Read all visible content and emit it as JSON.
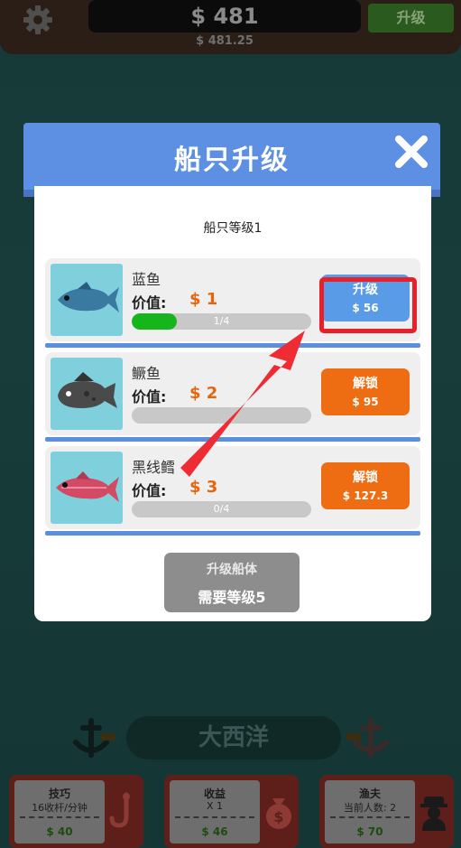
{
  "top": {
    "money": "$ 481",
    "money_exact": "$ 481.25",
    "upgrade_label": "升级"
  },
  "dialog": {
    "title": "船只升级",
    "level_label": "船只等级1",
    "fish": [
      {
        "name": "蓝鱼",
        "value_label": "价值:",
        "value": "$ 1",
        "progress_text": "1/4",
        "progress": 0.25,
        "button_label": "升级",
        "button_cost": "$ 56",
        "button_type": "upgrade"
      },
      {
        "name": "鳜鱼",
        "value_label": "价值:",
        "value": "$ 2",
        "progress_text": "",
        "progress": 0,
        "button_label": "解锁",
        "button_cost": "$ 95",
        "button_type": "unlock"
      },
      {
        "name": "黑线鳕",
        "value_label": "价值:",
        "value": "$ 3",
        "progress_text": "0/4",
        "progress": 0,
        "button_label": "解锁",
        "button_cost": "$ 127.3",
        "button_type": "unlock"
      }
    ],
    "hull_button": {
      "title": "升级船体",
      "requirement": "需要等级5"
    }
  },
  "bottom": {
    "ocean_name": "大西洋",
    "cards": [
      {
        "title": "技巧",
        "sub": "16收杆/分钟",
        "price": "$ 40",
        "icon": "hook-icon"
      },
      {
        "title": "收益",
        "sub": "X 1",
        "price": "$ 46",
        "icon": "money-bag-icon"
      },
      {
        "title": "渔夫",
        "sub": "当前人数: 2",
        "price": "$ 70",
        "icon": "fisherman-icon"
      }
    ]
  },
  "colors": {
    "header_blue": "#5d8fe2",
    "upgrade_blue": "#5a9be8",
    "unlock_orange": "#ef6d12",
    "value_orange": "#e5650f",
    "progress_green": "#16b51c",
    "highlight_red": "#e8202a"
  }
}
